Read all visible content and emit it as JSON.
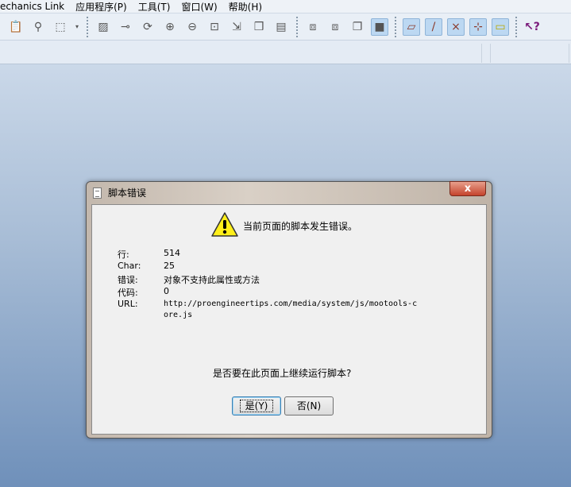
{
  "menubar": {
    "items": [
      "echanics Link",
      "应用程序(P)",
      "工具(T)",
      "窗口(W)",
      "帮助(H)"
    ]
  },
  "toolbar": {
    "icons": [
      "clipboard-icon",
      "binoculars-icon",
      "select-box-icon",
      "dropdown-icon",
      "sketch-icon",
      "datum-icon",
      "spin-icon",
      "zoom-in-icon",
      "zoom-out-icon",
      "refit-icon",
      "reorient-icon",
      "named-view-icon",
      "layers-icon",
      "wireframe-icon",
      "hidden-line-icon",
      "no-hidden-icon",
      "shading-icon",
      "datum-planes-icon",
      "datum-axes-icon",
      "datum-points-icon",
      "coord-sys-icon",
      "annotations-icon",
      "context-help-icon"
    ]
  },
  "dialog": {
    "title": "脚本错误",
    "close_label": "x",
    "message": "当前页面的脚本发生错误。",
    "fields": [
      {
        "label": "行:",
        "value": "514"
      },
      {
        "label": "Char:",
        "value": "25"
      },
      {
        "label": "错误:",
        "value": "对象不支持此属性或方法"
      },
      {
        "label": "代码:",
        "value": "0"
      },
      {
        "label": "URL:",
        "value": "http://proengineertips.com/media/system/js/mootools-core.js"
      }
    ],
    "question": "是否要在此页面上继续运行脚本?",
    "yes_label": "是(Y)",
    "no_label": "否(N)"
  }
}
